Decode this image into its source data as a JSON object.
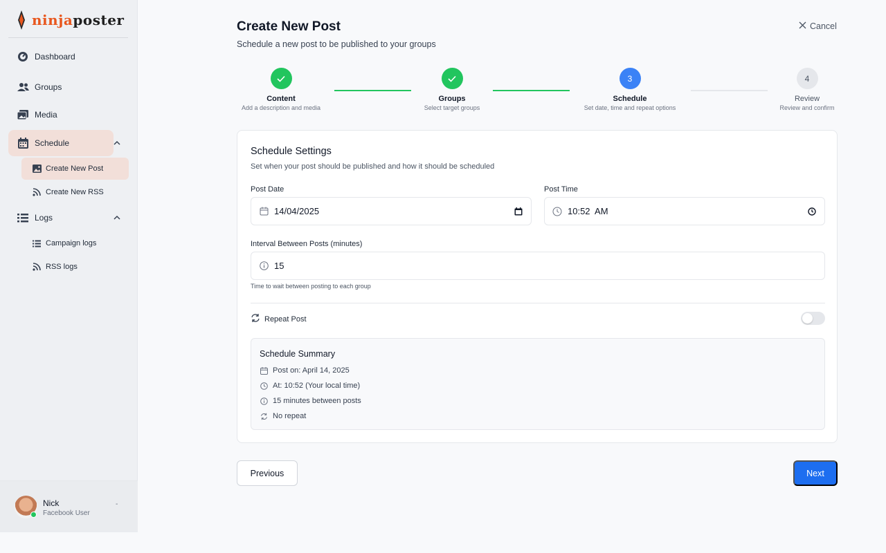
{
  "brand": {
    "part1": "ninja",
    "part2": "poster"
  },
  "sidebar": {
    "items": [
      {
        "label": "Dashboard",
        "icon": "dashboard-icon"
      },
      {
        "label": "Groups",
        "icon": "users-icon"
      },
      {
        "label": "Media",
        "icon": "media-icon"
      },
      {
        "label": "Schedule",
        "icon": "calendar-icon",
        "expanded": true
      },
      {
        "label": "Logs",
        "icon": "list-icon",
        "expanded": true
      }
    ],
    "schedule_sub": [
      {
        "label": "Create New Post",
        "icon": "image-icon",
        "active": true
      },
      {
        "label": "Create New RSS",
        "icon": "rss-icon"
      }
    ],
    "logs_sub": [
      {
        "label": "Campaign logs",
        "icon": "list-icon"
      },
      {
        "label": "RSS logs",
        "icon": "rss-icon"
      }
    ]
  },
  "user": {
    "name": "Nick",
    "role": "Facebook User",
    "status": "online"
  },
  "page": {
    "title": "Create New Post",
    "subtitle": "Schedule a new post to be published to your groups",
    "cancel_label": "Cancel"
  },
  "steps": [
    {
      "label": "Content",
      "desc": "Add a description and media",
      "state": "done"
    },
    {
      "label": "Groups",
      "desc": "Select target groups",
      "state": "done"
    },
    {
      "number": "3",
      "label": "Schedule",
      "desc": "Set date, time and repeat options",
      "state": "current"
    },
    {
      "number": "4",
      "label": "Review",
      "desc": "Review and confirm",
      "state": "todo"
    }
  ],
  "card": {
    "title": "Schedule Settings",
    "desc": "Set when your post should be published and how it should be scheduled",
    "post_date_label": "Post Date",
    "post_date_value": "14/04/2025",
    "post_time_label": "Post Time",
    "post_time_value": "10:52  AM",
    "interval_label": "Interval Between Posts (minutes)",
    "interval_value": "15",
    "interval_hint": "Time to wait between posting to each group",
    "repeat_label": "Repeat Post",
    "repeat_enabled": false
  },
  "summary": {
    "title": "Schedule Summary",
    "rows": [
      {
        "icon": "calendar-icon",
        "text": "Post on: April 14, 2025"
      },
      {
        "icon": "clock-icon",
        "text": "At: 10:52 (Your local time)"
      },
      {
        "icon": "info-icon",
        "text": "15 minutes between posts"
      },
      {
        "icon": "repeat-icon",
        "text": "No repeat"
      }
    ]
  },
  "buttons": {
    "previous": "Previous",
    "next": "Next"
  },
  "colors": {
    "accent": "#1d6ef0",
    "done": "#22c55e",
    "current": "#3b82f6",
    "active_nav": "#f2dfd9",
    "brand": "#e8571e"
  }
}
